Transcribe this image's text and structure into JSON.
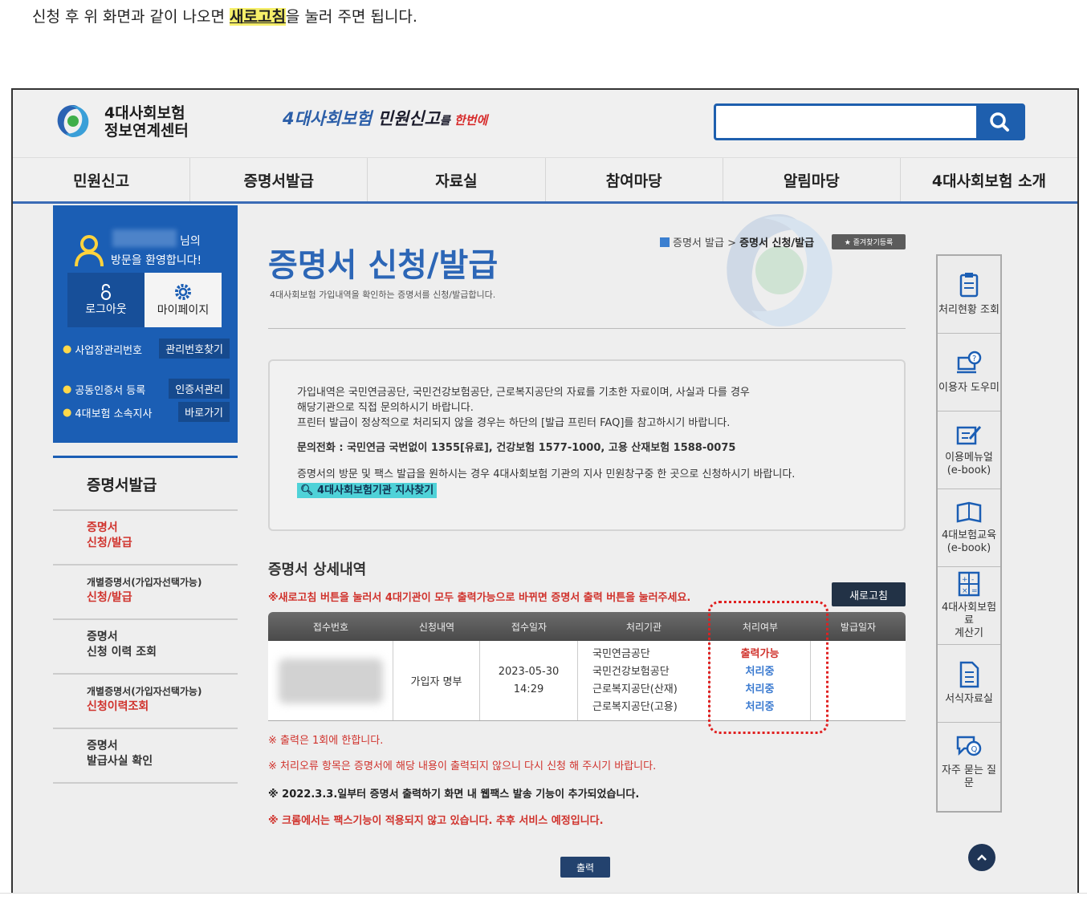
{
  "caption": {
    "before": "신청 후 위 화면과 같이 나오면 ",
    "highlight": "새로고침",
    "after": "을 눌러 주면 됩니다."
  },
  "header": {
    "logo_line1": "4대사회보험",
    "logo_line2": "정보연계센터",
    "slogan_blue": "4대사회보험",
    "slogan_dark": " 민원신고",
    "slogan_small": "를",
    "slogan_red": " 한번에",
    "search_placeholder": "",
    "search_icon": "search-icon"
  },
  "nav": [
    "민원신고",
    "증명서발급",
    "자료실",
    "참여마당",
    "알림마당",
    "4대사회보험 소개"
  ],
  "user": {
    "nim": "님의",
    "welcome": "방문을 환영합니다!",
    "logout": "로그아웃",
    "mypage": "마이페이지",
    "rows": [
      {
        "label": "사업장관리번호",
        "btn": "관리번호찾기"
      },
      {
        "label": "공동인증서 등록",
        "btn": "인증서관리"
      },
      {
        "label": "4대보험 소속지사",
        "btn": "바로가기"
      }
    ]
  },
  "leftmenu": {
    "title": "증명서발급",
    "items": [
      {
        "line1": "증명서",
        "line2": "신청/발급"
      },
      {
        "line1": "개별증명서(가입자선택가능)",
        "line2": "신청/발급"
      },
      {
        "line1": "증명서",
        "line2": "신청 이력 조회"
      },
      {
        "line1": "개별증명서(가입자선택가능)",
        "line2": "신청이력조회"
      },
      {
        "line1": "증명서",
        "line2": "발급사실 확인"
      }
    ]
  },
  "main": {
    "title": "증명서 신청/발급",
    "subtitle": "4대사회보험 가입내역을 확인하는 증명서를 신청/발급합니다.",
    "crumb_parent": "증명서 발급 > ",
    "crumb_current": "증명서 신청/발급",
    "fav": "★ 즐겨찾기등록",
    "notice1": "가입내역은 국민연금공단, 국민건강보험공단, 근로복지공단의 자료를 기초한 자료이며, 사실과 다를 경우",
    "notice2": "해당기관으로 직접 문의하시기 바랍니다.",
    "notice3": "프린터 발급이 정상적으로 처리되지 않을 경우는 하단의 [발급 프린터 FAQ]를 참고하시기 바랍니다.",
    "phone": "문의전화 : 국민연금 국번없이 1355[유료], 건강보험 1577-1000, 고용 산재보험 1588-0075",
    "visit": "증명서의 방문 및 팩스 발급을 원하시는 경우 4대사회보험 기관의 지사 민원창구중 한 곳으로 신청하시기 바랍니다.",
    "find": "4대사회보험기관 지사찾기",
    "detail_title": "증명서 상세내역",
    "detail_note": "※새로고침 버튼을 눌러서 4대기관이 모두 출력가능으로 바뀌면 증명서 출력 버튼을 눌러주세요.",
    "refresh": "새로고침",
    "columns": [
      "접수번호",
      "신청내역",
      "접수일자",
      "처리기관",
      "처리여부",
      "발급일자"
    ],
    "row": {
      "type": "가입자 명부",
      "date": "2023-05-30",
      "time": "14:29",
      "agencies": [
        "국민연금공단",
        "국민건강보험공단",
        "근로복지공단(산재)",
        "근로복지공단(고용)"
      ],
      "statuses": [
        "출력가능",
        "처리중",
        "처리중",
        "처리중"
      ]
    },
    "foot1": "※ 출력은 1회에 한합니다.",
    "foot2": "※ 처리오류 항목은 증명서에 해당 내용이 출력되지 않으니 다시 신청 해 주시기 바랍니다.",
    "foot3": "※ 2022.3.3.일부터 증명서 출력하기 화면 내 웹팩스 발송 기능이 추가되었습니다.",
    "foot4": "※ 크롬에서는 팩스기능이 적용되지 않고 있습니다. 추후 서비스 예정입니다.",
    "print": "출력"
  },
  "quick": [
    {
      "label": "처리현황 조회",
      "icon": "clipboard-icon"
    },
    {
      "label": "이용자 도우미",
      "icon": "help-monitor-icon"
    },
    {
      "label": "이용메뉴얼\n(e-book)",
      "icon": "pencil-icon"
    },
    {
      "label": "4대보험교육\n(e-book)",
      "icon": "book-icon"
    },
    {
      "label": "4대사회보험료\n계산기",
      "icon": "calculator-icon"
    },
    {
      "label": "서식자료실",
      "icon": "document-icon"
    },
    {
      "label": "자주 묻는 질문",
      "icon": "chat-icon"
    }
  ],
  "colors": {
    "brand_blue": "#1b5eb4",
    "accent_red": "#d0322c",
    "highlight": "#f6ef6a"
  }
}
